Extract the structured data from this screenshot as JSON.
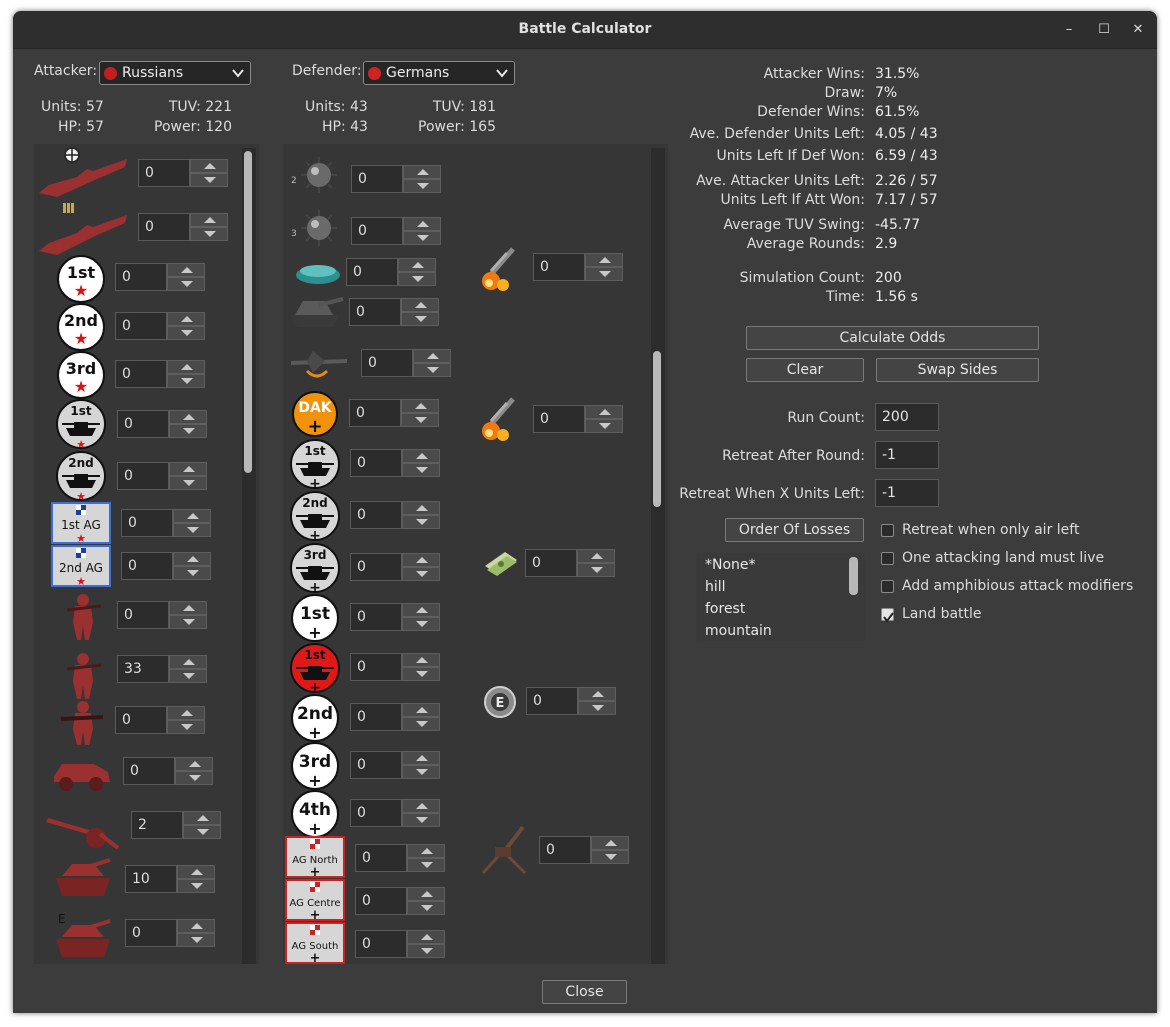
{
  "window": {
    "title": "Battle Calculator",
    "minimize_glyph": "–",
    "maximize_glyph": "☐",
    "close_glyph": "✕"
  },
  "attacker": {
    "label": "Attacker:",
    "nation": "Russians",
    "flag_color": "#c41e1e",
    "units_text": "Units: 57",
    "hp_text": "HP: 57",
    "tuv_text": "TUV: 221",
    "power_text": "Power: 120",
    "counts": [
      "0",
      "0",
      "0",
      "0",
      "0",
      "0",
      "0",
      "0",
      "0",
      "0",
      "33",
      "0",
      "0",
      "2",
      "10",
      "0"
    ],
    "icons": [
      "battleship-target-icon",
      "battleship-ammo-icon",
      "1st-guards-token-icon",
      "2nd-guards-token-icon",
      "3rd-guards-token-icon",
      "1st-tank-army-token-icon",
      "2nd-tank-army-token-icon",
      "1st-ag-token-icon",
      "2nd-ag-token-icon",
      "rifleman-icon",
      "rifleman-icon",
      "machine-gunner-icon",
      "armored-car-icon",
      "artillery-icon",
      "tank-icon",
      "elite-tank-icon"
    ]
  },
  "defender": {
    "label": "Defender:",
    "nation": "Germans",
    "flag_color": "#d12222",
    "units_text": "Units: 43",
    "hp_text": "HP: 43",
    "tuv_text": "TUV: 181",
    "power_text": "Power: 165",
    "counts": [
      "0",
      "0",
      "0",
      "0",
      "0",
      "0",
      "0",
      "0",
      "0",
      "0",
      "0",
      "0",
      "0",
      "0",
      "0",
      "0",
      "0",
      "0"
    ],
    "icons": [
      "naval-mine-icon",
      "naval-mine-icon",
      "landmine-icon",
      "bunker-tank-icon",
      "stuka-icon",
      "dak-token-icon",
      "1st-panzer-token-icon",
      "2nd-panzer-token-icon",
      "3rd-panzer-token-icon",
      "1st-army-token-icon",
      "1st-ss-panzer-token-icon",
      "2nd-army-token-icon",
      "3rd-army-token-icon",
      "4th-army-token-icon",
      "ag-north-token-icon",
      "ag-centre-token-icon",
      "ag-south-token-icon"
    ],
    "extra_counts": [
      "0",
      "0",
      "0",
      "0",
      "0"
    ],
    "extra_icons": [
      "bombardment-icon",
      "bombardment-icon",
      "money-icon",
      "engineer-badge-icon",
      "anti-air-gun-icon"
    ],
    "ag_labels": [
      "AG North",
      "AG Centre",
      "AG South"
    ],
    "token_labels": [
      "1st",
      "2nd",
      "3rd",
      "1st",
      "2nd",
      "3rd",
      "4th",
      "DAK",
      "1st AG",
      "2nd AG"
    ]
  },
  "results": {
    "attacker_wins_label": "Attacker Wins:",
    "attacker_wins": "31.5%",
    "draw_label": "Draw:",
    "draw": "7%",
    "defender_wins_label": "Defender Wins:",
    "defender_wins": "61.5%",
    "ave_def_left_label": "Ave. Defender Units Left:",
    "ave_def_left": "4.05 / 43",
    "left_if_def_won_label": "Units Left If Def Won:",
    "left_if_def_won": "6.59 / 43",
    "ave_att_left_label": "Ave. Attacker Units Left:",
    "ave_att_left": "2.26 / 57",
    "left_if_att_won_label": "Units Left If Att Won:",
    "left_if_att_won": "7.17 / 57",
    "tuv_swing_label": "Average TUV Swing:",
    "tuv_swing": "-45.77",
    "avg_rounds_label": "Average Rounds:",
    "avg_rounds": "2.9",
    "sim_count_label": "Simulation Count:",
    "sim_count": "200",
    "time_label": "Time:",
    "time": "1.56 s"
  },
  "controls": {
    "calculate_label": "Calculate Odds",
    "clear_label": "Clear",
    "swap_label": "Swap Sides",
    "run_count_label": "Run Count:",
    "run_count": "200",
    "retreat_round_label": "Retreat After Round:",
    "retreat_round": "-1",
    "retreat_units_label": "Retreat When X Units Left:",
    "retreat_units": "-1",
    "order_of_losses_label": "Order Of Losses",
    "terrain_options": [
      "*None*",
      "hill",
      "forest",
      "mountain"
    ],
    "checkboxes": [
      {
        "label": "Retreat when only air left",
        "checked": false
      },
      {
        "label": "One attacking land must live",
        "checked": false
      },
      {
        "label": "Add amphibious attack modifiers",
        "checked": false
      },
      {
        "label": "Land battle",
        "checked": true
      }
    ],
    "close_label": "Close"
  },
  "colors": {
    "russian_unit": "#9a3030",
    "german_unit": "#5a5a5a",
    "red_star": "#d11",
    "ag_border_blue": "#3b6fd6",
    "ag_border_red": "#c22"
  }
}
